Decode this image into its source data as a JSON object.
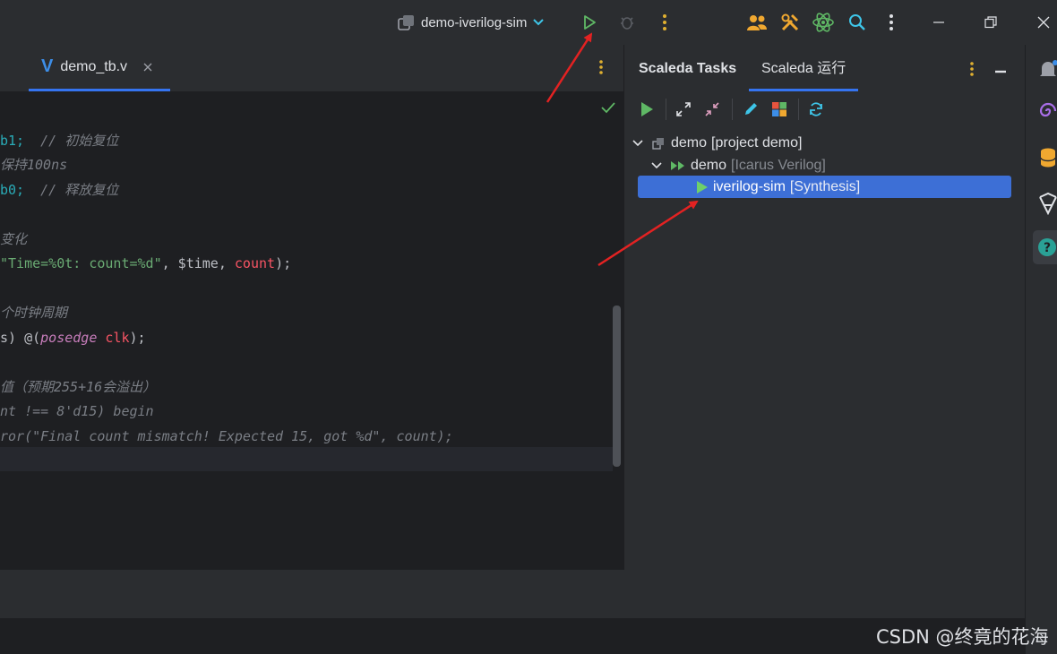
{
  "titlebar": {
    "run_config": "demo-iverilog-sim"
  },
  "editor": {
    "tab_name": "demo_tb.v",
    "code": [
      {
        "parts": [
          {
            "t": "b1;",
            "c": "num"
          },
          {
            "t": "  ",
            "c": "pl"
          },
          {
            "t": "// 初始复位",
            "c": "cm"
          }
        ]
      },
      {
        "parts": [
          {
            "t": "保持100ns",
            "c": "cm"
          }
        ]
      },
      {
        "parts": [
          {
            "t": "b0;",
            "c": "num"
          },
          {
            "t": "  ",
            "c": "pl"
          },
          {
            "t": "// 释放复位",
            "c": "cm"
          }
        ]
      },
      {
        "parts": []
      },
      {
        "parts": [
          {
            "t": "变化",
            "c": "cm"
          }
        ]
      },
      {
        "parts": [
          {
            "t": "\"Time=%0t: count=%d\"",
            "c": "str"
          },
          {
            "t": ", $time, ",
            "c": "pl"
          },
          {
            "t": "count",
            "c": "var"
          },
          {
            "t": ");",
            "c": "pl"
          }
        ]
      },
      {
        "parts": []
      },
      {
        "parts": [
          {
            "t": "个时钟周期",
            "c": "cm"
          }
        ]
      },
      {
        "parts": [
          {
            "t": "s) @(",
            "c": "pl"
          },
          {
            "t": "posedge",
            "c": "kw"
          },
          {
            "t": " ",
            "c": "pl"
          },
          {
            "t": "clk",
            "c": "var"
          },
          {
            "t": ");",
            "c": "pl"
          }
        ]
      },
      {
        "parts": []
      },
      {
        "parts": [
          {
            "t": "值（预期255+16会溢出）",
            "c": "cm"
          }
        ]
      },
      {
        "parts": [
          {
            "t": "nt !== 8'd15) begin",
            "c": "cm"
          }
        ]
      },
      {
        "parts": [
          {
            "t": "ror(\"Final count mismatch! Expected 15, got %d\", count);",
            "c": "cm"
          }
        ]
      }
    ]
  },
  "tool_window": {
    "tabs": [
      "Scaleda Tasks",
      "Scaleda 运行"
    ],
    "tree": [
      {
        "name": "demo",
        "detail": "[project demo]"
      },
      {
        "name": "demo",
        "detail": "[Icarus Verilog]"
      },
      {
        "name": "iverilog-sim",
        "detail": "[Synthesis]"
      }
    ]
  },
  "watermark": "CSDN @终竟的花海",
  "colors": {
    "accent": "#3574f0",
    "run_green": "#5fb865",
    "annotation_red": "#e32222"
  }
}
